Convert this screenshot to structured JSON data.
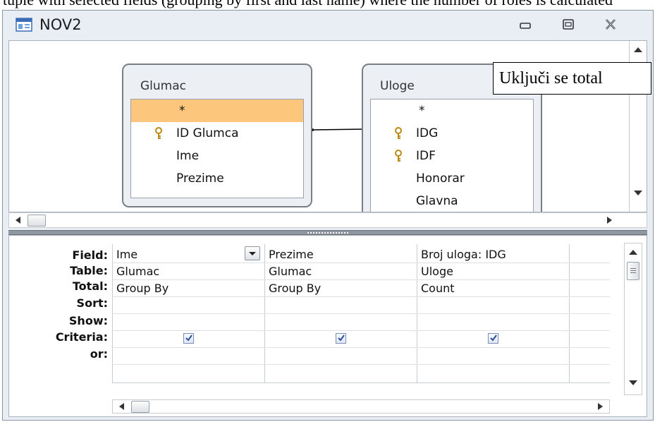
{
  "top_text": "tuple with selected fields (grouping by first and last name) where the number of roles is calculated",
  "window": {
    "title": "NOV2"
  },
  "tables": [
    {
      "title": "Glumac",
      "fields": [
        "*",
        "ID Glumca",
        "Ime",
        "Prezime"
      ],
      "keys": [
        false,
        true,
        false,
        false
      ],
      "selected_index": 0
    },
    {
      "title": "Uloge",
      "fields": [
        "*",
        "IDG",
        "IDF",
        "Honorar",
        "Glavna"
      ],
      "keys": [
        false,
        true,
        true,
        false,
        false
      ],
      "selected_index": -1
    }
  ],
  "callout": "Uključi se total",
  "grid": {
    "row_labels": [
      "Field:",
      "Table:",
      "Total:",
      "Sort:",
      "Show:",
      "Criteria:",
      "or:"
    ],
    "columns": [
      {
        "field": "Ime",
        "table": "Glumac",
        "total": "Group By",
        "sort": "",
        "show": true,
        "criteria": "",
        "or": ""
      },
      {
        "field": "Prezime",
        "table": "Glumac",
        "total": "Group By",
        "sort": "",
        "show": true,
        "criteria": "",
        "or": ""
      },
      {
        "field": "Broj uloga: IDG",
        "table": "Uloge",
        "total": "Count",
        "sort": "",
        "show": true,
        "criteria": "",
        "or": ""
      }
    ]
  },
  "icons": [
    "app-icon",
    "minimize-icon",
    "maximize-icon",
    "close-icon",
    "key-icon",
    "scroll-up-arrow-icon",
    "scroll-down-arrow-icon",
    "scroll-left-arrow-icon",
    "scroll-right-arrow-icon",
    "dropdown-arrow-icon",
    "checkbox-check-icon"
  ],
  "colors": {
    "selected_field": "#fcc77c",
    "window_bg": "#e9eef5"
  }
}
